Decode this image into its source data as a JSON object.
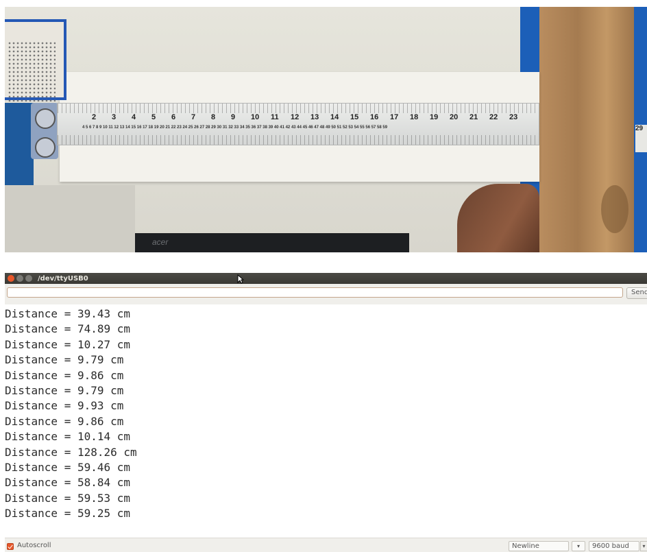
{
  "photo": {
    "ruler_big_numbers": [
      "2",
      "3",
      "4",
      "5",
      "6",
      "7",
      "8",
      "9",
      "10",
      "11",
      "12",
      "13",
      "14",
      "15",
      "16",
      "17",
      "18",
      "19",
      "20",
      "21",
      "22",
      "23"
    ],
    "ruler_small_numbers": "4 5 6 7 8 9 10 11 12 13 14 15 16 17 18 19 20 21 22 23 24 25 26 27 28 29 30 31 32 33 34 35 36 37 38 39 40 41 42 43 44 45 46 47 48 49 50 51 52 53 54 55 56 57 58 59",
    "ruler_right_number": "29",
    "monitor_logo": "acer"
  },
  "window": {
    "title": "/dev/ttyUSB0"
  },
  "toolbar": {
    "input_value": "",
    "send_label": "Send"
  },
  "output": {
    "lines": [
      "Distance = 39.43 cm",
      "Distance = 74.89 cm",
      "Distance = 10.27 cm",
      "Distance = 9.79 cm",
      "Distance = 9.86 cm",
      "Distance = 9.79 cm",
      "Distance = 9.93 cm",
      "Distance = 9.86 cm",
      "Distance = 10.14 cm",
      "Distance = 128.26 cm",
      "Distance = 59.46 cm",
      "Distance = 58.84 cm",
      "Distance = 59.53 cm",
      "Distance = 59.25 cm"
    ]
  },
  "statusbar": {
    "autoscroll_label": "Autoscroll",
    "autoscroll_checked": true,
    "line_ending": "Newline",
    "baud_rate": "9600 baud",
    "dropdown_arrow": "▾"
  },
  "colors": {
    "close_button": "#e8572a",
    "titlebar": "#3a3935"
  }
}
